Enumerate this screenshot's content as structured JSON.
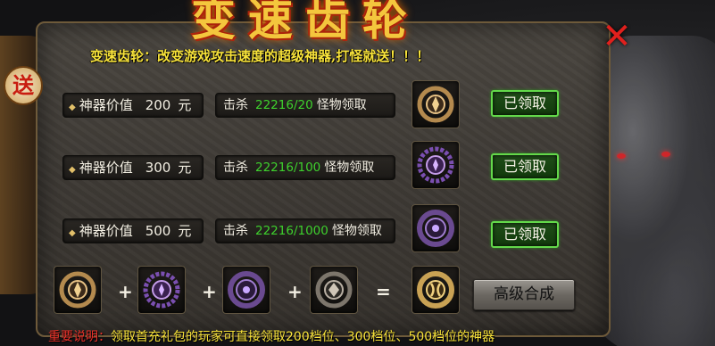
{
  "window": {
    "title_art": "变速齿轮",
    "close_label": "✕",
    "badge": "送"
  },
  "subtitle": "变速齿轮：改变游戏攻击速度的超级神器,打怪就送！！！",
  "rows": [
    {
      "value_label": "神器价值",
      "value_amount": "200",
      "value_unit": "元",
      "kill_label": "击杀",
      "kill_count": "22216/20",
      "kill_suffix": "怪物领取",
      "claim_label": "已领取",
      "icon": "bronze-gear-icon"
    },
    {
      "value_label": "神器价值",
      "value_amount": "300",
      "value_unit": "元",
      "kill_label": "击杀",
      "kill_count": "22216/100",
      "kill_suffix": "怪物领取",
      "claim_label": "已领取",
      "icon": "purple-gear-icon"
    },
    {
      "value_label": "神器价值",
      "value_amount": "500",
      "value_unit": "元",
      "kill_label": "击杀",
      "kill_count": "22216/1000",
      "kill_suffix": "怪物领取",
      "claim_label": "已领取",
      "icon": "violet-gear-icon"
    }
  ],
  "combine": {
    "operators": [
      "+",
      "+",
      "+",
      "="
    ],
    "button_label": "高级合成",
    "items": [
      "bronze-gear-icon",
      "purple-gear-icon",
      "violet-gear-icon",
      "silver-gear-icon",
      "gold-gear-icon"
    ]
  },
  "notice": {
    "label": "重要说明：",
    "text": "领取首充礼包的玩家可直接领取200档位、300档位、500档位的神器"
  },
  "colors": {
    "accent_gold": "#f7e23a",
    "kill_green": "#3ed12d",
    "claim_border": "#63d94a",
    "notice_red": "#e8322a",
    "close_red": "#e0201d"
  }
}
